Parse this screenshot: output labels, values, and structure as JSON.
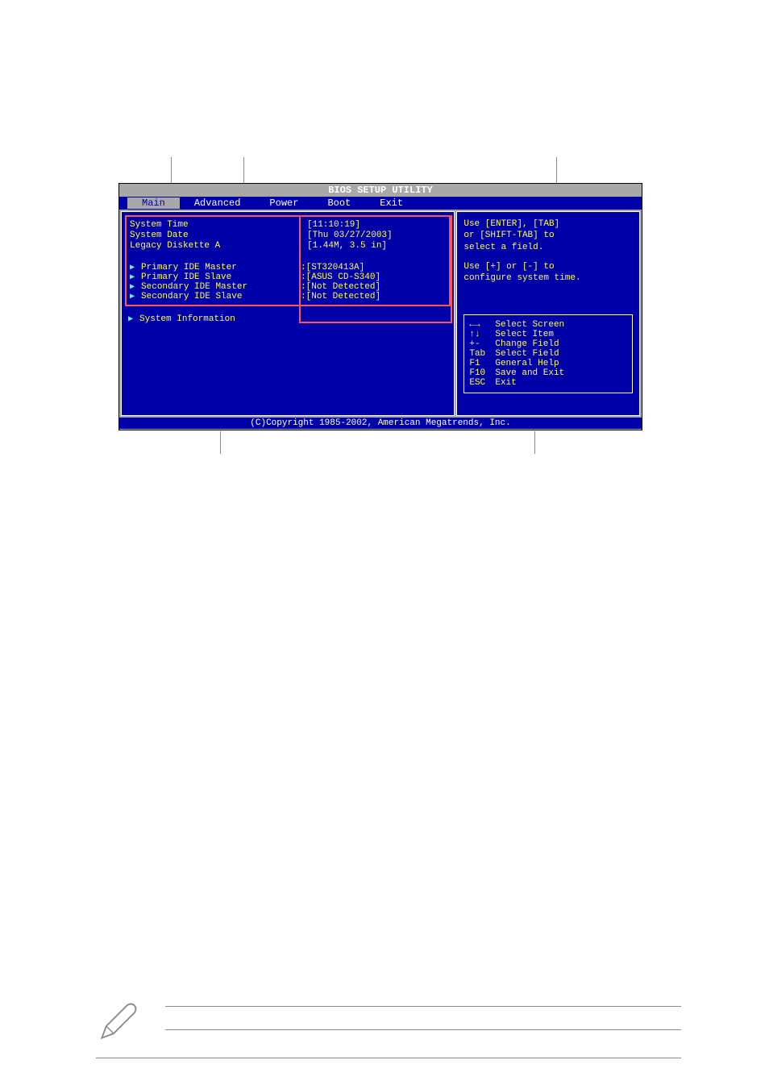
{
  "title": "BIOS SETUP UTILITY",
  "menu": {
    "items": [
      "Main",
      "Advanced",
      "Power",
      "Boot",
      "Exit"
    ],
    "selected": 0
  },
  "main": {
    "system_time_label": "System Time",
    "system_time_value": "[11:10:19]",
    "system_date_label": "System Date",
    "system_date_value": "[Thu 03/27/2003]",
    "legacy_diskette_label": "Legacy Diskette A",
    "legacy_diskette_value": "[1.44M, 3.5 in]",
    "ide": [
      {
        "label": "Primary IDE Master",
        "value": ":[ST320413A]"
      },
      {
        "label": "Primary IDE Slave",
        "value": ":[ASUS CD-S340]"
      },
      {
        "label": "Secondary IDE Master",
        "value": ":[Not Detected]"
      },
      {
        "label": "Secondary IDE Slave",
        "value": ":[Not Detected]"
      }
    ],
    "system_info_label": "System Information"
  },
  "help": {
    "line1": "Use [ENTER], [TAB]",
    "line2": "or [SHIFT-TAB] to",
    "line3": "select a field.",
    "line4": "Use [+] or [-] to",
    "line5": "configure system time."
  },
  "nav": {
    "select_screen": "Select Screen",
    "select_item": "Select Item",
    "change_field_key": "+-",
    "change_field": "Change Field",
    "select_field_key": "Tab",
    "select_field": "Select Field",
    "general_help_key": "F1",
    "general_help": "General Help",
    "save_exit_key": "F10",
    "save_exit": "Save and Exit",
    "exit_key": "ESC",
    "exit": "Exit"
  },
  "copyright": "(C)Copyright 1985-2002, American Megatrends, Inc."
}
